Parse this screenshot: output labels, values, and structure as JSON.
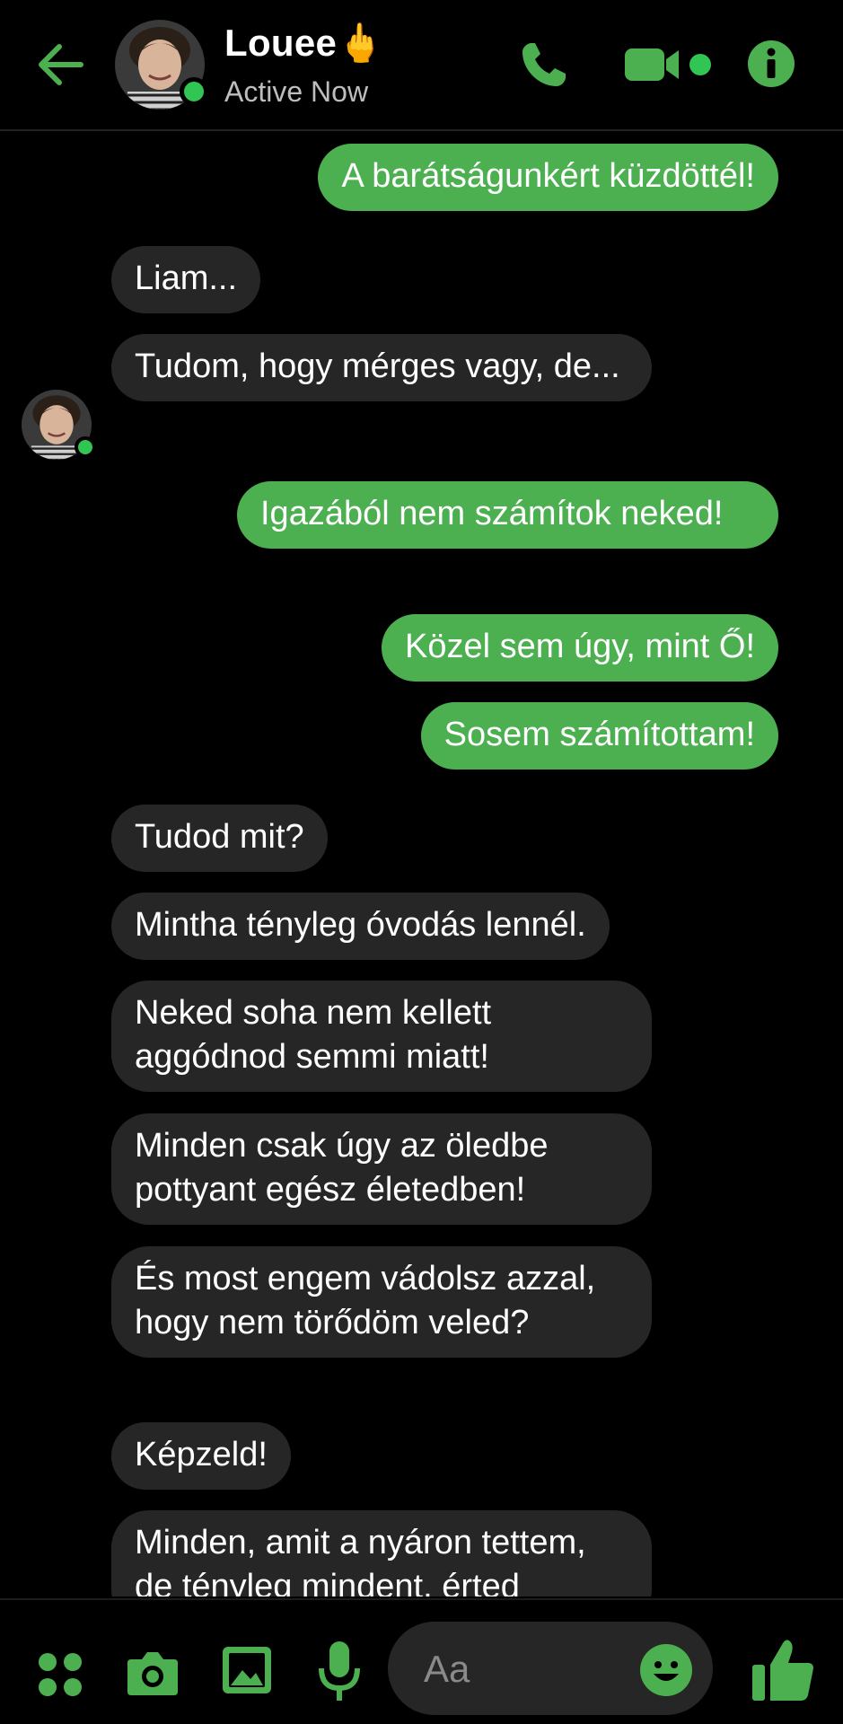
{
  "header": {
    "contact_name": "Louee",
    "contact_emoji": "🖕",
    "status": "Active Now",
    "back_icon": "arrow-left-icon",
    "icons": [
      "phone-icon",
      "video-camera-icon",
      "info-icon"
    ]
  },
  "colors": {
    "accent": "#4caf50",
    "background": "#000000",
    "incoming_bubble": "#262626",
    "online": "#31c653"
  },
  "messages": [
    {
      "direction": "out",
      "text": "A barátságunkért küzdöttél!"
    },
    {
      "direction": "in",
      "text": "Liam..."
    },
    {
      "direction": "in",
      "text": "Tudom, hogy mérges vagy, de..."
    },
    {
      "direction": "out",
      "text": "Igazából nem számítok neked!"
    },
    {
      "direction": "out",
      "text": "Közel sem úgy, mint Ő!"
    },
    {
      "direction": "out",
      "text": "Sosem számítottam!"
    },
    {
      "direction": "in",
      "text": "Tudod mit?"
    },
    {
      "direction": "in",
      "text": "Mintha tényleg óvodás lennél."
    },
    {
      "direction": "in",
      "text": "Neked soha nem kellett aggódnod semmi miatt!"
    },
    {
      "direction": "in",
      "text": "Minden csak úgy az öledbe pottyant egész életedben!"
    },
    {
      "direction": "in",
      "text": "És most engem vádolsz azzal, hogy nem törődöm veled?"
    },
    {
      "direction": "in",
      "text": "Képzeld!"
    },
    {
      "direction": "in",
      "text": "Minden, amit a nyáron tettem, de tényleg mindent, érted"
    }
  ],
  "composer": {
    "placeholder": "Aa",
    "icons": [
      "apps-icon",
      "camera-icon",
      "image-icon",
      "microphone-icon",
      "emoji-icon",
      "thumbs-up-icon"
    ]
  }
}
